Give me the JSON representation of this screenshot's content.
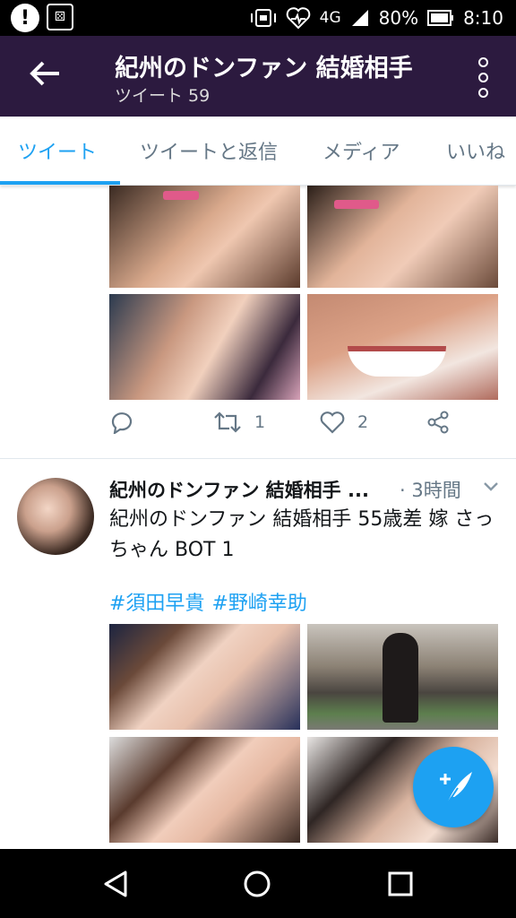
{
  "status_bar": {
    "network": "4G",
    "battery": "80%",
    "time": "8:10",
    "left_icons": [
      "alert-icon",
      "dice-icon"
    ],
    "right_icons": [
      "vibrate-icon",
      "heart-rate-icon",
      "signal-icon",
      "battery-icon"
    ]
  },
  "app_bar": {
    "title": "紀州のドンファン 結婚相手",
    "subtitle": "ツイート 59",
    "icons": [
      "back-arrow-icon",
      "more-vert-icon"
    ]
  },
  "tabs": [
    {
      "label": "ツイート",
      "active": true
    },
    {
      "label": "ツイートと返信",
      "active": false
    },
    {
      "label": "メディア",
      "active": false
    },
    {
      "label": "いいね",
      "active": false
    }
  ],
  "tweet1": {
    "photos": [
      "photo-1",
      "photo-2",
      "photo-3",
      "photo-4"
    ],
    "actions": {
      "reply_count": "",
      "retweet_count": "1",
      "like_count": "2"
    }
  },
  "tweet2": {
    "name": "紀州のドンファン 結婚相手 ...",
    "time": "· 3時間",
    "text": "紀州のドンファン 結婚相手 55歳差 嫁 さっちゃん BOT 1",
    "hashtags": [
      "#須田早貴",
      "#野崎幸助"
    ],
    "photos": [
      "photo-1",
      "photo-2",
      "photo-3",
      "photo-4"
    ]
  },
  "fab": {
    "icon": "compose-tweet-icon"
  },
  "nav_bar": {
    "icons": [
      "back-icon",
      "home-icon",
      "recents-icon"
    ]
  },
  "colors": {
    "app_bar": "#2c1a3f",
    "accent": "#1da1f2",
    "muted": "#657786",
    "text": "#14171a"
  }
}
